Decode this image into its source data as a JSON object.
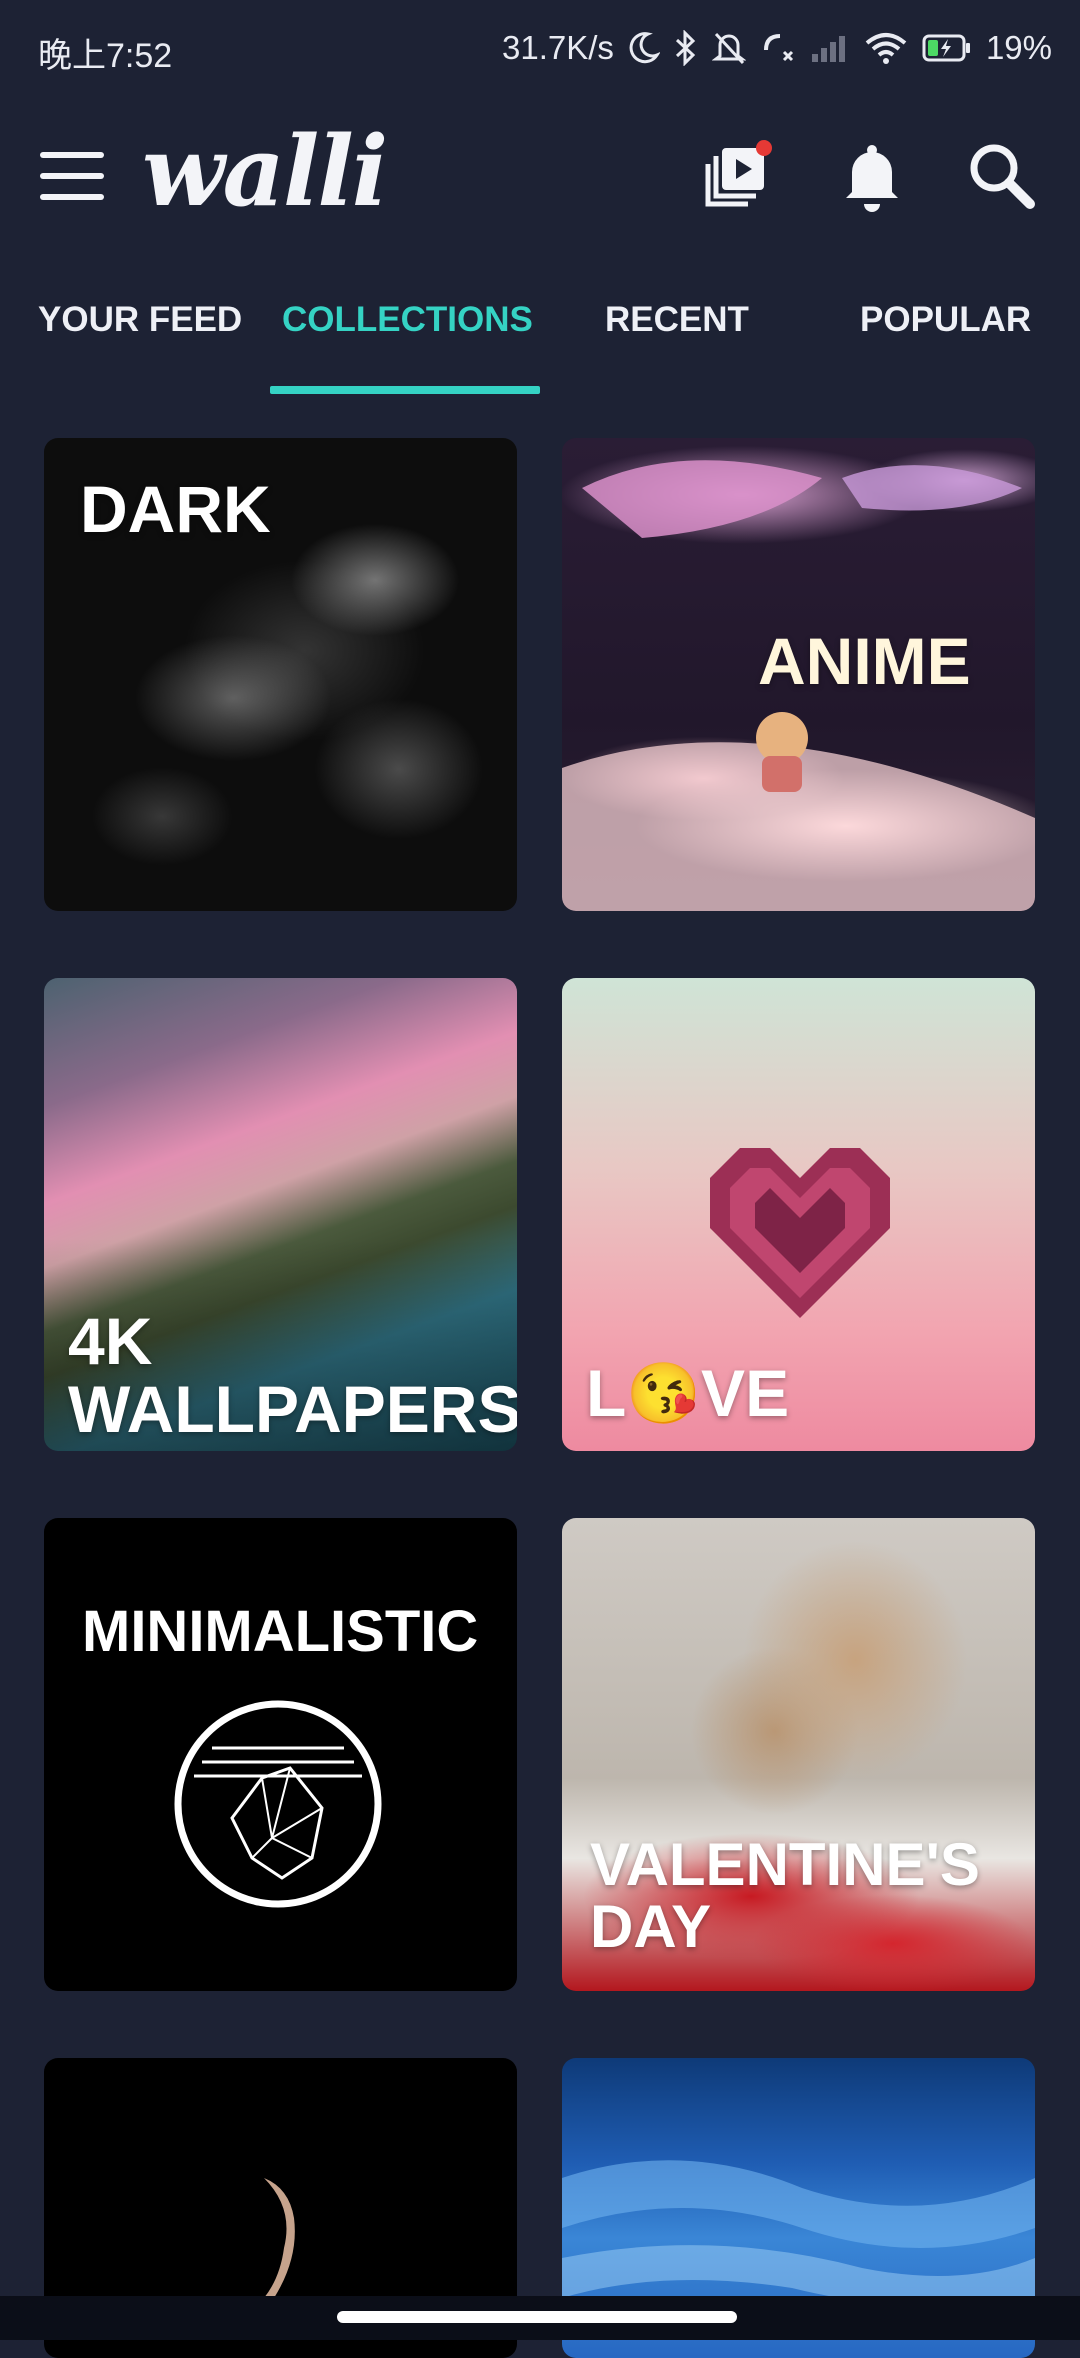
{
  "status_bar": {
    "time": "晚上7:52",
    "network_speed": "31.7K/s",
    "battery": "19%",
    "icons": [
      "moon-icon",
      "bluetooth-icon",
      "mute-bell-icon",
      "no-call-icon",
      "signal-icon",
      "wifi-icon",
      "battery-icon"
    ]
  },
  "app_bar": {
    "logo": "walli",
    "icons": [
      "menu-icon",
      "video-collection-icon",
      "bell-icon",
      "search-icon"
    ],
    "notification_dot_color": "#e53935"
  },
  "tabs": [
    {
      "label": "YOUR FEED",
      "active": false
    },
    {
      "label": "COLLECTIONS",
      "active": true
    },
    {
      "label": "RECENT",
      "active": false
    },
    {
      "label": "POPULAR",
      "active": false
    }
  ],
  "accent_color": "#35d3c4",
  "collections": [
    {
      "label": "DARK"
    },
    {
      "label": "ANIME"
    },
    {
      "label_line1": "4K",
      "label_line2": "WALLPAPERS"
    },
    {
      "label_prefix": "L",
      "label_emoji": "😘",
      "label_suffix": "VE"
    },
    {
      "label": "MINIMALISTIC"
    },
    {
      "label_line1": "VALENTINE'S",
      "label_line2": "DAY"
    }
  ]
}
